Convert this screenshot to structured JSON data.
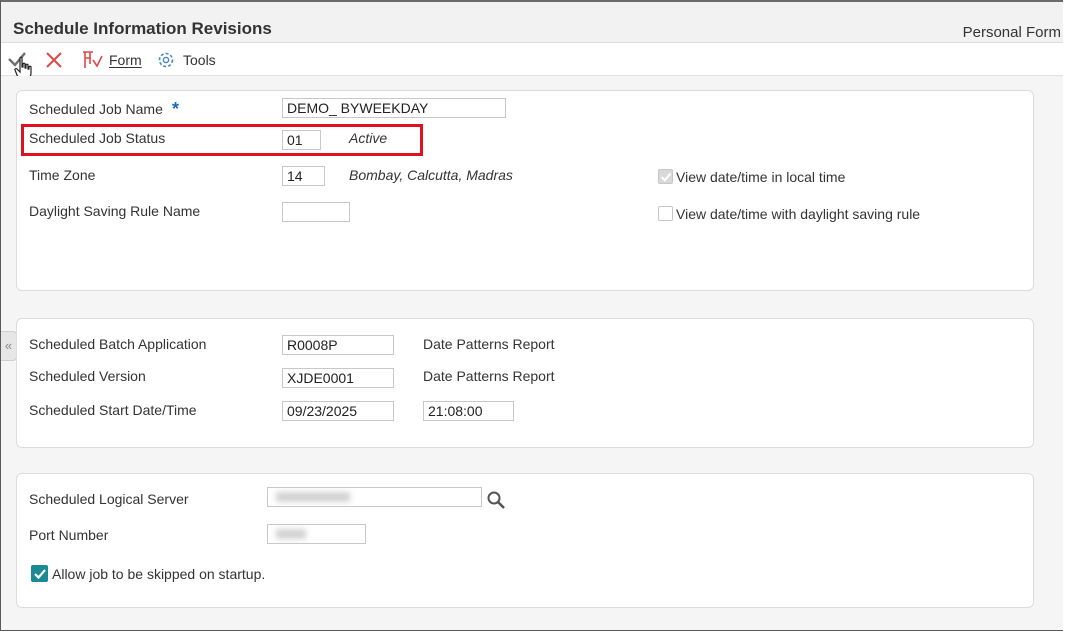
{
  "header": {
    "title": "Schedule Information Revisions",
    "personal_form": "Personal Form"
  },
  "toolbar": {
    "ok_icon": "checkmark-icon",
    "cancel_icon": "close-icon",
    "form_label": "Form",
    "tools_label": "Tools"
  },
  "section1": {
    "job_name_label": "Scheduled Job Name",
    "required_marker": "*",
    "job_name_value": "DEMO_ BYWEEKDAY",
    "job_status_label": "Scheduled Job Status",
    "job_status_value": "01",
    "job_status_desc": "Active",
    "time_zone_label": "Time Zone",
    "time_zone_value": "14",
    "time_zone_desc": "Bombay, Calcutta, Madras",
    "dst_rule_label": "Daylight Saving Rule Name",
    "dst_rule_value": "",
    "local_time_label": "View date/time in local time",
    "local_time_checked": true,
    "dst_view_label": "View date/time with daylight saving rule",
    "dst_view_checked": false
  },
  "section2": {
    "batch_app_label": "Scheduled Batch Application",
    "batch_app_value": "R0008P",
    "batch_app_desc": "Date Patterns Report",
    "version_label": "Scheduled Version",
    "version_value": "XJDE0001",
    "version_desc": "Date Patterns Report",
    "start_label": "Scheduled Start Date/Time",
    "start_date": "09/23/2025",
    "start_time": "21:08:00"
  },
  "section3": {
    "server_label": "Scheduled Logical Server",
    "server_value": "",
    "port_label": "Port Number",
    "port_value": "",
    "skip_label": "Allow job to be skipped on startup.",
    "skip_checked": true
  },
  "colors": {
    "highlight": "#e01020",
    "required": "#1a6bb5",
    "checkbox_checked": "#1a8a94"
  }
}
